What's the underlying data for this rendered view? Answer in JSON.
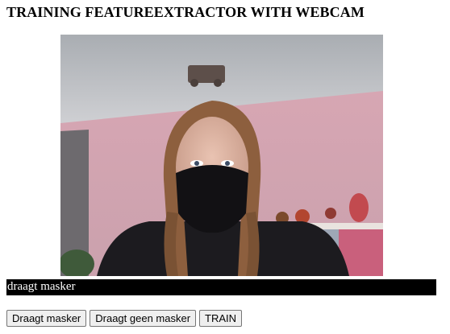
{
  "page": {
    "title": "TRAINING FEATUREEXTRACTOR WITH WEBCAM"
  },
  "webcam": {
    "icon": "webcam-video-feed"
  },
  "result": {
    "label": "draagt masker"
  },
  "buttons": {
    "mask_label": "Draagt masker",
    "no_mask_label": "Draagt geen masker",
    "train_label": "TRAIN"
  },
  "colors": {
    "result_bar_bg": "#000000",
    "result_bar_text": "#ffffff",
    "button_bg": "#efefef"
  }
}
